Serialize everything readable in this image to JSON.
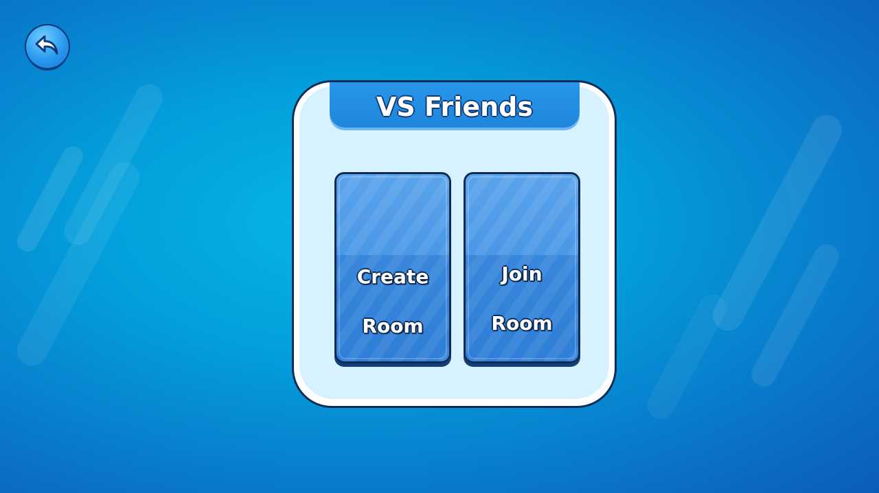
{
  "screen": {
    "background_color": "#039fdc",
    "accent_color": "#1f86dc"
  },
  "back_button": {
    "icon": "back-arrow-icon"
  },
  "panel": {
    "title": "VS Friends"
  },
  "options": [
    {
      "line1": "Create",
      "line2": "Room",
      "icon": ""
    },
    {
      "line1": "Join",
      "line2": "Room",
      "icon": ""
    }
  ]
}
